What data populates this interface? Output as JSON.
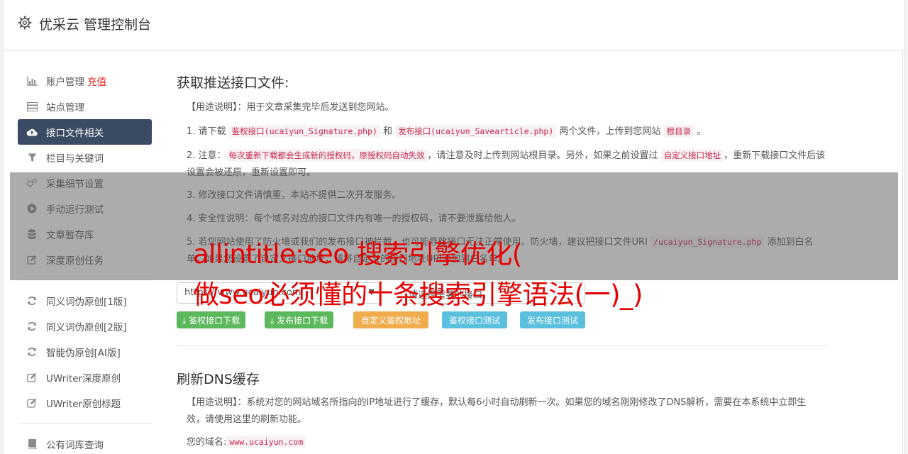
{
  "header": {
    "title": "优采云 管理控制台",
    "icon": "gear-icon"
  },
  "sidebar": {
    "group1": [
      {
        "label": "账户管理",
        "badge": "充值",
        "icon": "bar-chart-icon"
      },
      {
        "label": "站点管理",
        "icon": "server-icon"
      },
      {
        "label": "接口文件相关",
        "icon": "cloud-upload-icon",
        "active": true
      },
      {
        "label": "栏目与关键词",
        "icon": "filter-icon"
      },
      {
        "label": "采集细节设置",
        "icon": "cogs-icon"
      },
      {
        "label": "手动运行测试",
        "icon": "play-circle-icon"
      },
      {
        "label": "文章暂存库",
        "icon": "database-icon"
      },
      {
        "label": "深度原创任务",
        "icon": "edit-icon"
      }
    ],
    "group2": [
      {
        "label": "同义词伪原创[1版]",
        "icon": "refresh-icon"
      },
      {
        "label": "同义词伪原创[2版]",
        "icon": "refresh-icon"
      },
      {
        "label": "智能伪原创[AI版]",
        "icon": "refresh-icon"
      },
      {
        "label": "UWriter深度原创",
        "icon": "edit-icon"
      },
      {
        "label": "UWriter原创标题",
        "icon": "edit-icon"
      }
    ],
    "group3": [
      {
        "label": "公有词库查询",
        "icon": "book-icon"
      }
    ]
  },
  "section1": {
    "title": "获取推送接口文件:",
    "usage": "【用途说明】：用于文章采集完毕后发送到您网站。",
    "item1": {
      "p1": "1. 请下载 ",
      "code1": "鉴权接口(ucaiyun_Signature.php)",
      "p2": " 和 ",
      "code2": "发布接口(ucaiyun_Savearticle.php)",
      "p3": " 两个文件，上传到您网站 ",
      "code3": "根目录",
      "p4": " 。"
    },
    "item2": {
      "p1": "2. 注意：",
      "code1": "每次重新下载都会生成新的授权码，原授权码自动失效",
      "p2": "，请注意及时上传到网站根目录。另外，如果之前设置过 ",
      "code2": "自定义接口地址",
      "p3": "，重新下载接口文件后该设置会被还原，重新设置即可。"
    },
    "item3": "3. 修改接口文件请慎重，本站不提供二次开发服务。",
    "item4": "4. 安全性说明：每个域名对应的接口文件内有唯一的授权码，请不要泄露给他人。",
    "item5": {
      "p1": "5. 若您网站使用了防火墙或我们的发布接口被拦截，也可能导致接口无法正常使用。防火墙，建议把接口文件URI ",
      "code1": "/ucaiyun_Signature.php",
      "p2": " 添加到白名单，如果您设置了自定义接口地址，请将自定义的接口地址URI添加到白名单。"
    },
    "protocol_value": "https://www.ucaiyun.com",
    "interface_value": "请选择需要的接口",
    "buttons": {
      "sign_download": "鉴权接口下载",
      "publish_download": "发布接口下载",
      "custom_sign": "自定义鉴权地址",
      "sign_test": "鉴权接口测试",
      "publish_test": "发布接口测试"
    }
  },
  "section2": {
    "title": "刷新DNS缓存",
    "usage": "【用途说明】：系统对您的网站域名所指向的IP地址进行了缓存，默认每6小时自动刷新一次。如果您的域名刚刚修改了DNS解析，需要在本系统中立即生效，请使用这里的刷新功能。",
    "domain_label": "您的域名:",
    "domain_value": "www.ucaiyun.com"
  },
  "overlay": {
    "line1": "allintitle:seo 搜索引擎优化(",
    "line2": "做seo必须懂的十条搜索引擎语法(一)_)"
  }
}
